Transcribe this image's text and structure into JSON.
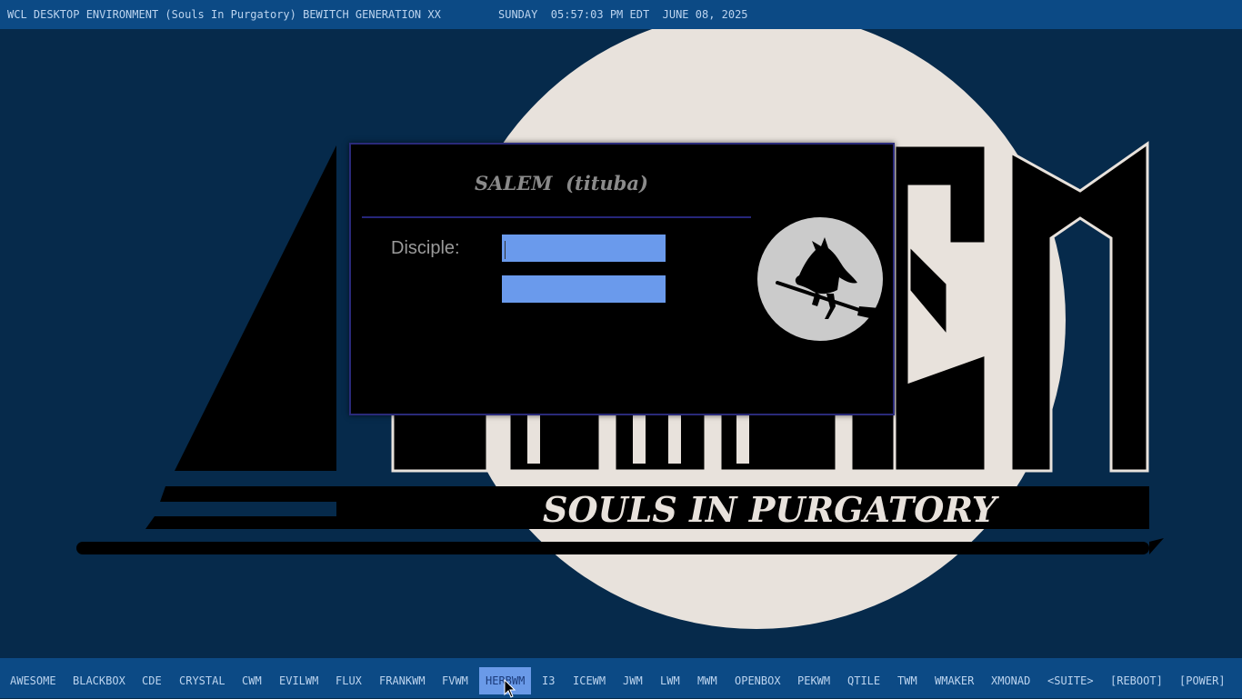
{
  "topbar": {
    "title": "WCL DESKTOP ENVIRONMENT (Souls In Purgatory) BEWITCH GENERATION XX",
    "clock": "SUNDAY  05:57:03 PM EDT  JUNE 08, 2025"
  },
  "wallpaper": {
    "tagline": "SOULS IN PURGATORY",
    "moon_color": "#e8e2dc",
    "background_color": "#062a4b"
  },
  "dialog": {
    "heading": "SALEM  (tituba)",
    "username_label": "Disciple:",
    "username_value": "",
    "password_value": "",
    "logo_icon": "witch-on-broom-icon"
  },
  "taskbar": {
    "active_item": "HERBWM",
    "items": [
      "AWESOME",
      "BLACKBOX",
      "CDE",
      "CRYSTAL",
      "CWM",
      "EVILWM",
      "FLUX",
      "FRANKWM",
      "FVWM",
      "HERBWM",
      "I3",
      "ICEWM",
      "JWM",
      "LWM",
      "MWM",
      "OPENBOX",
      "PEKWM",
      "QTILE",
      "TWM",
      "WMAKER",
      "XMONAD",
      "<SUITE>",
      "[REBOOT]",
      "[POWER]"
    ]
  },
  "colors": {
    "bar": "#0c4a85",
    "bar_text": "#bcd4ef",
    "accent": "#6a9aec"
  }
}
